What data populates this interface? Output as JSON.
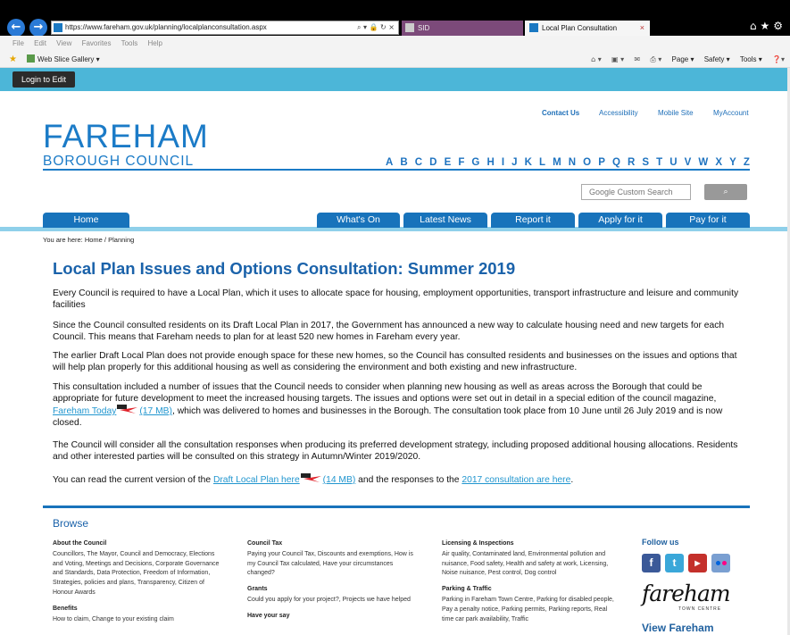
{
  "browser": {
    "url": "https://www.fareham.gov.uk/planning/localplanconsultation.aspx",
    "tabs": [
      {
        "label": "SID"
      },
      {
        "label": "Local Plan Consultation",
        "close": "×"
      }
    ],
    "menu": [
      "File",
      "Edit",
      "View",
      "Favorites",
      "Tools",
      "Help"
    ],
    "favorites": {
      "gallery": "Web Slice Gallery ▾"
    },
    "command_bar": {
      "page": "Page ▾",
      "safety": "Safety ▾",
      "tools": "Tools ▾"
    }
  },
  "login": {
    "label": "Login to Edit"
  },
  "header": {
    "top_links": {
      "contact": "Contact Us",
      "accessibility": "Accessibility",
      "mobile": "Mobile Site",
      "account": "MyAccount"
    },
    "logo_main": "FAREHAM",
    "logo_sub": "BOROUGH COUNCIL",
    "az": [
      "A",
      "B",
      "C",
      "D",
      "E",
      "F",
      "G",
      "H",
      "I",
      "J",
      "K",
      "L",
      "M",
      "N",
      "O",
      "P",
      "Q",
      "R",
      "S",
      "T",
      "U",
      "V",
      "W",
      "X",
      "Y",
      "Z"
    ],
    "search": {
      "placeholder": "Google Custom Search"
    }
  },
  "nav": {
    "home": "Home",
    "whats_on": "What's On",
    "news": "Latest News",
    "report": "Report it",
    "apply": "Apply for it",
    "pay": "Pay for it"
  },
  "breadcrumb": "You are here: Home / Planning",
  "content": {
    "title": "Local Plan Issues and Options Consultation: Summer 2019",
    "p1": "Every Council is required to have a Local Plan, which it uses to allocate space for housing, employment opportunities, transport infrastructure and leisure and community facilities",
    "p2": "Since the Council consulted residents on its Draft Local Plan in 2017, the Government has announced a new way to calculate housing need and new targets for each Council. This means that Fareham needs to plan for at least 520 new homes in Fareham every year.",
    "p3": "The earlier Draft Local Plan does not provide enough space for these new homes, so the Council has consulted residents and businesses on the issues and options that will help plan properly for this additional housing as well as considering the environment and both existing and new infrastructure.",
    "p4_a": "This consultation included a number of issues that the Council needs to consider when planning new housing as well as areas across the Borough that could be appropriate for future development to meet the increased housing targets. The issues and options were set out in detail in a special edition of the council magazine, ",
    "p4_link": "Fareham Today",
    "p4_size": "(17 MB)",
    "p4_b": ", which was delivered to homes and businesses in the Borough. The consultation took place from 10 June until 26 July 2019 and is now closed.",
    "p5": "The Council will consider all the consultation responses when producing its preferred development strategy, including proposed additional housing allocations. Residents and other interested parties will be consulted on this strategy in Autumn/Winter 2019/2020.",
    "p6_a": "You can read the current version of the ",
    "p6_link": "Draft Local Plan here",
    "p6_size": "(14 MB)",
    "p6_b": " and the responses to the ",
    "p6_link2": "2017 consultation are here",
    "p6_c": "."
  },
  "browse": {
    "title": "Browse",
    "col1": [
      {
        "h": "About the Council",
        "t": "Councillors, The Mayor, Council and Democracy, Elections and Voting, Meetings and Decisions, Corporate Governance and Standards, Data Protection, Freedom of Information, Strategies, policies and plans, Transparency, Citizen of Honour Awards"
      },
      {
        "h": "Benefits",
        "t": "How to claim, Change to your existing claim"
      }
    ],
    "col2": [
      {
        "h": "Council Tax",
        "t": "Paying your Council Tax, Discounts and exemptions, How is my Council Tax calculated, Have your circumstances changed?"
      },
      {
        "h": "Grants",
        "t": "Could you apply for your project?, Projects we have helped"
      },
      {
        "h": "Have your say",
        "t": ""
      }
    ],
    "col3": [
      {
        "h": "Licensing & Inspections",
        "t": "Air quality, Contaminated land, Environmental pollution and nuisance, Food safety, Health and safety at work, Licensing, Noise nuisance, Pest control, Dog control"
      },
      {
        "h": "Parking & Traffic",
        "t": "Parking in Fareham Town Centre, Parking for disabled people, Pay a penalty notice, Parking permits, Parking reports, Real time car park availability, Traffic"
      }
    ],
    "follow": "Follow us",
    "town_logo": "fareham",
    "town_sub": "TOWN CENTRE",
    "view": "View Fareham"
  }
}
